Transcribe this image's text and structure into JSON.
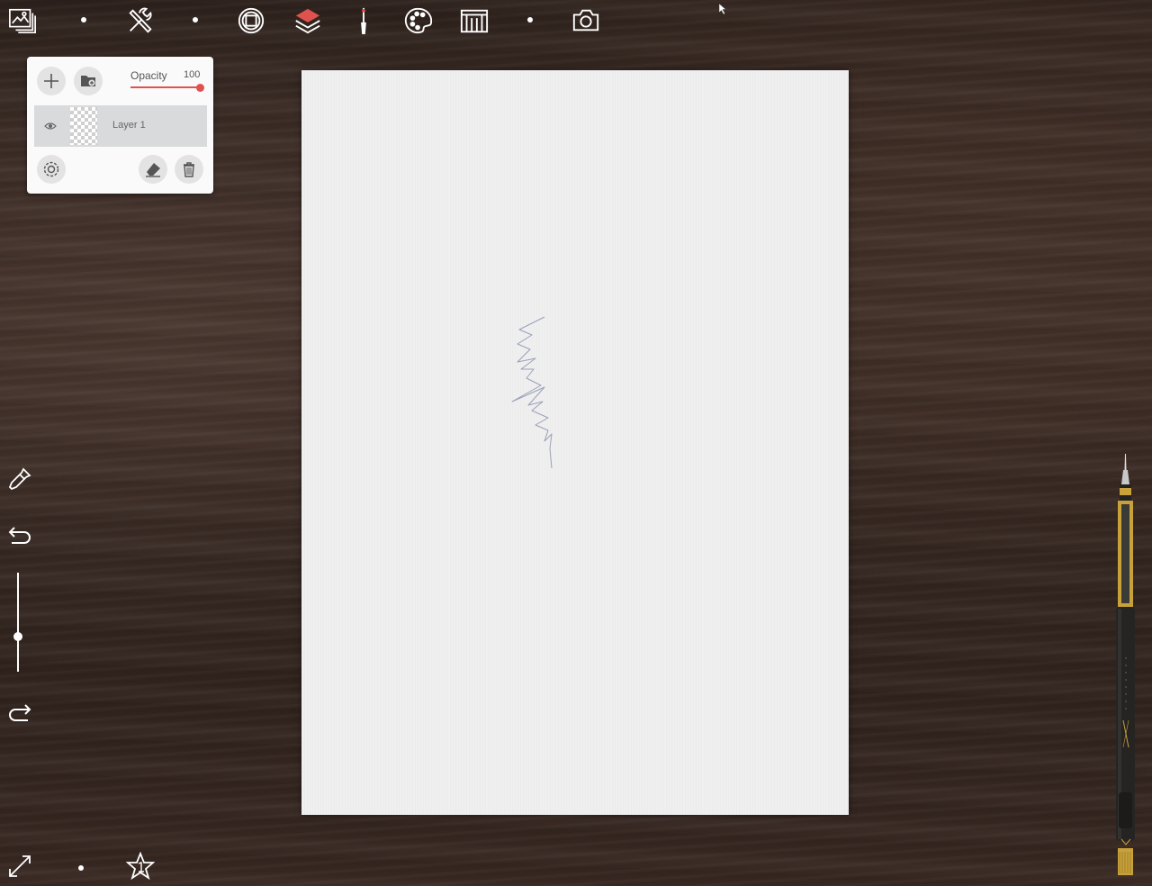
{
  "toolbar": {
    "items": [
      {
        "name": "gallery-icon"
      },
      {
        "name": "transform-tools-icon"
      },
      {
        "name": "canvas-frame-icon"
      },
      {
        "name": "layers-icon"
      },
      {
        "name": "brush-icon"
      },
      {
        "name": "palette-icon"
      },
      {
        "name": "ruler-guide-icon"
      },
      {
        "name": "camera-icon"
      }
    ],
    "accent_color": "#e0524d"
  },
  "layers_panel": {
    "opacity_label": "Opacity",
    "opacity_value": "100",
    "opacity_level": 1.0,
    "layers": [
      {
        "name": "Layer 1",
        "visible": true
      }
    ]
  },
  "left_tools": {
    "brush_size_level": 0.4
  }
}
